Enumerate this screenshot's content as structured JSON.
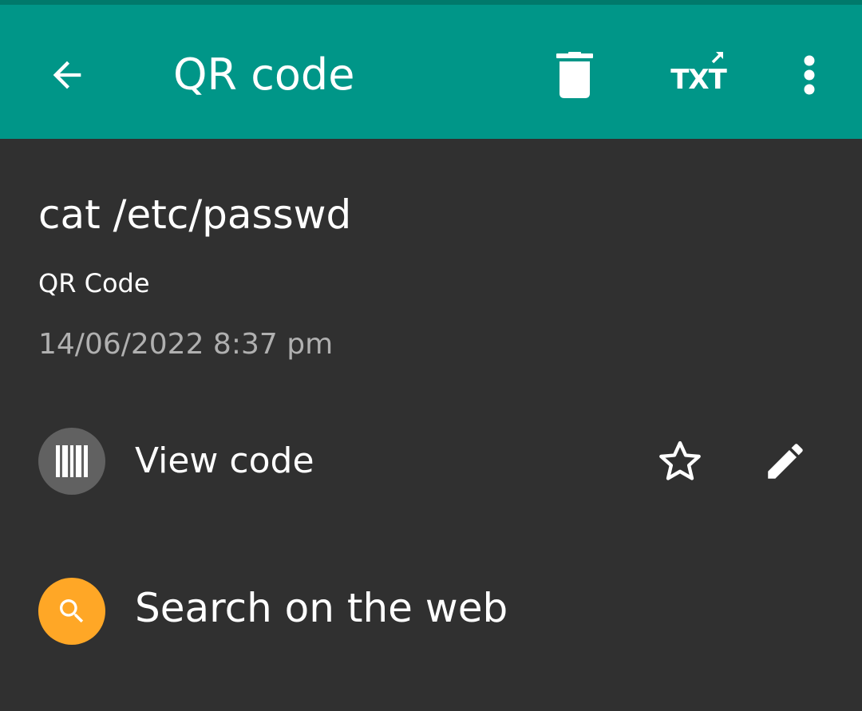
{
  "app_bar": {
    "title": "QR code",
    "back_icon": "arrow-back-icon",
    "delete_icon": "trash-icon",
    "export_label": "TXT",
    "more_icon": "more-vert-icon"
  },
  "barcode": {
    "text": "cat /etc/passwd",
    "format": "QR Code",
    "date": "14/06/2022 8:37 pm"
  },
  "actions": [
    {
      "label": "View code",
      "icon": "barcode-icon",
      "circle_color": "#616161"
    },
    {
      "label": "Search on the web",
      "icon": "search-icon",
      "circle_color": "#ffa726"
    }
  ],
  "colors": {
    "app_bar": "#009688",
    "status_strip": "#00796b",
    "background": "#303030",
    "date_text": "#b0b0b0"
  }
}
